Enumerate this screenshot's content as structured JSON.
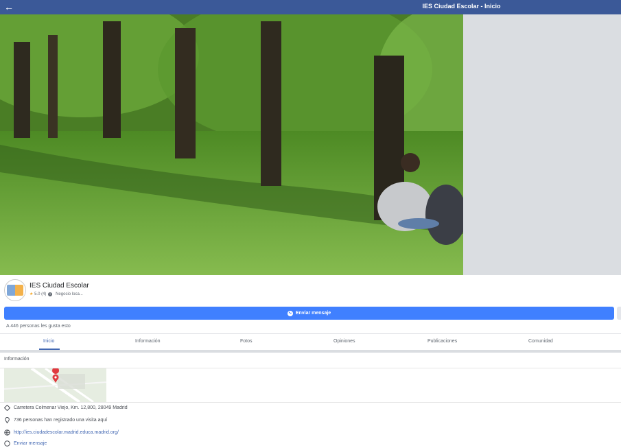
{
  "topbar": {
    "title": "IES Ciudad Escolar - Inicio",
    "back_icon": "arrow-left-icon"
  },
  "page": {
    "name": "IES Ciudad Escolar",
    "rating": "5.0 (4)",
    "category": "Negocio loca..."
  },
  "actions": {
    "send_message": "Enviar mensaje"
  },
  "likes_text": "A 446 personas les gusta esto",
  "tabs": [
    {
      "label": "Inicio",
      "active": true
    },
    {
      "label": "Información"
    },
    {
      "label": "Fotos"
    },
    {
      "label": "Opiniones"
    },
    {
      "label": "Publicaciones"
    },
    {
      "label": "Comunidad"
    }
  ],
  "info": {
    "title": "Información",
    "address": "Carretera Colmenar Viejo, Km. 12,800, 28049 Madrid",
    "checkins": "736 personas han registrado una visita aquí",
    "website": "http://ies.ciudadescolar.madrid.educa.madrid.org/",
    "message_link": "Enviar mensaje"
  },
  "colors": {
    "brand": "#3b5998",
    "button": "#4080ff",
    "link": "#4267b2"
  }
}
